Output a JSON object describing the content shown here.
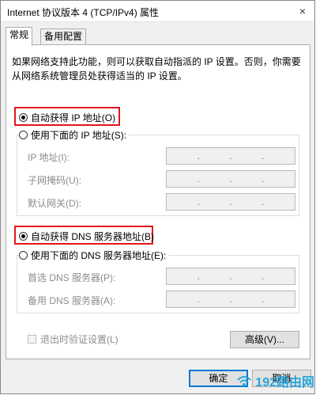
{
  "window": {
    "title": "Internet 协议版本 4 (TCP/IPv4) 属性",
    "close_label": "×"
  },
  "tabs": [
    {
      "label": "常规"
    },
    {
      "label": "备用配置"
    }
  ],
  "description": "如果网络支持此功能，则可以获取自动指派的 IP 设置。否则，你需要从网络系统管理员处获得适当的 IP 设置。",
  "ip": {
    "auto_label": "自动获得 IP 地址(O)",
    "manual_label": "使用下面的 IP 地址(S):",
    "fields": [
      {
        "label": "IP 地址(I):",
        "value": ". . ."
      },
      {
        "label": "子网掩码(U):",
        "value": ". . ."
      },
      {
        "label": "默认网关(D):",
        "value": ". . ."
      }
    ],
    "selected": "auto"
  },
  "dns": {
    "auto_label": "自动获得 DNS 服务器地址(B)",
    "manual_label": "使用下面的 DNS 服务器地址(E):",
    "fields": [
      {
        "label": "首选 DNS 服务器(P):",
        "value": ". . ."
      },
      {
        "label": "备用 DNS 服务器(A):",
        "value": ". . ."
      }
    ],
    "selected": "auto"
  },
  "validate_on_exit": {
    "label": "退出时验证设置(L)",
    "checked": false
  },
  "buttons": {
    "advanced": "高级(V)...",
    "ok": "确定",
    "cancel": "取消"
  },
  "watermark": {
    "text": "192路由网"
  },
  "colors": {
    "highlight": "#e0161b",
    "accent": "#0078d7",
    "watermark": "#17a0da"
  }
}
